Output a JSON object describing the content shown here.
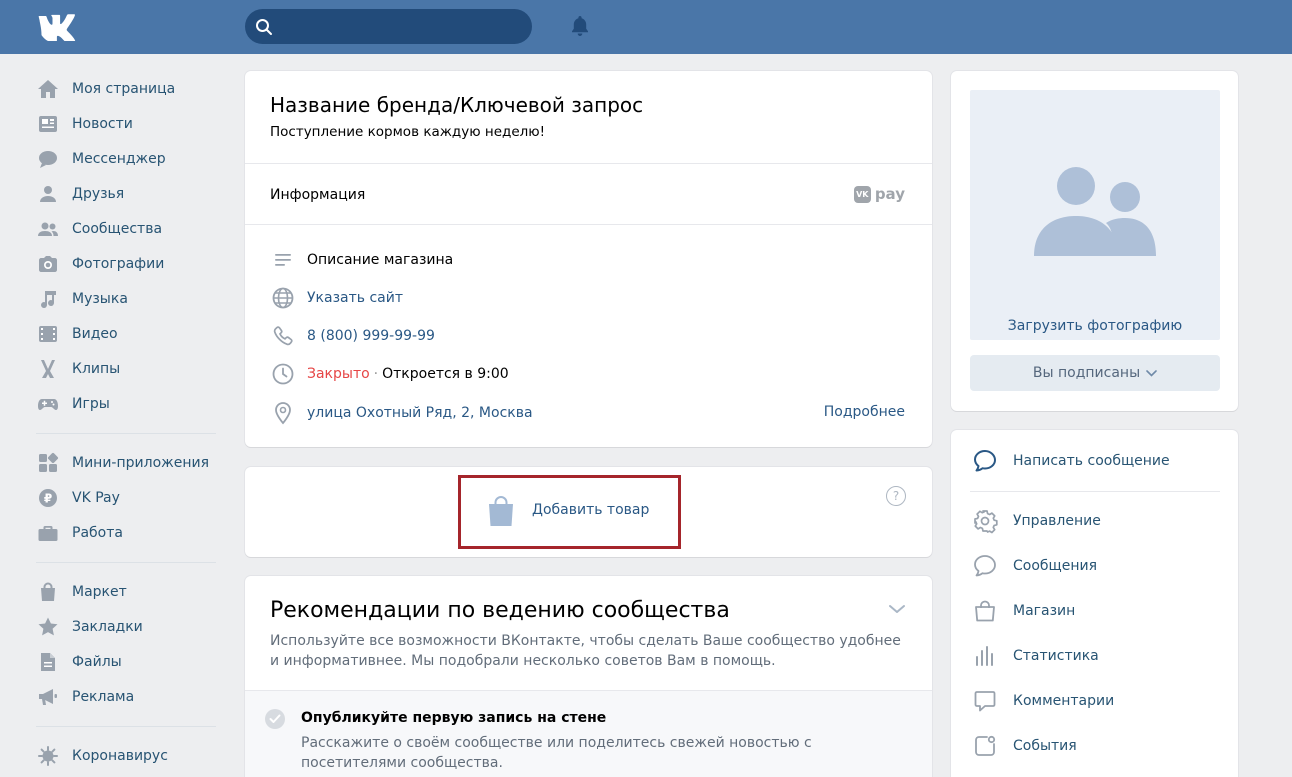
{
  "header": {
    "logo_text": "VK"
  },
  "nav": {
    "items": [
      {
        "label": "Моя страница",
        "icon": "home-icon"
      },
      {
        "label": "Новости",
        "icon": "news-icon"
      },
      {
        "label": "Мессенджер",
        "icon": "messenger-icon"
      },
      {
        "label": "Друзья",
        "icon": "friends-icon"
      },
      {
        "label": "Сообщества",
        "icon": "communities-icon"
      },
      {
        "label": "Фотографии",
        "icon": "camera-icon"
      },
      {
        "label": "Музыка",
        "icon": "music-icon"
      },
      {
        "label": "Видео",
        "icon": "video-icon"
      },
      {
        "label": "Клипы",
        "icon": "clips-icon"
      },
      {
        "label": "Игры",
        "icon": "gamepad-icon"
      },
      {
        "label": "Мини-приложения",
        "icon": "mini-apps-icon"
      },
      {
        "label": "VK Pay",
        "icon": "vkpay-icon"
      },
      {
        "label": "Работа",
        "icon": "briefcase-icon"
      },
      {
        "label": "Маркет",
        "icon": "market-icon"
      },
      {
        "label": "Закладки",
        "icon": "star-icon"
      },
      {
        "label": "Файлы",
        "icon": "file-icon"
      },
      {
        "label": "Реклама",
        "icon": "ads-icon"
      },
      {
        "label": "Коронавирус",
        "icon": "virus-icon"
      }
    ]
  },
  "community": {
    "title": "Название бренда/Ключевой запрос",
    "status": "Поступление кормов каждую неделю!",
    "info_label": "Информация",
    "vkpay_label": "pay",
    "description": "Описание магазина",
    "website": "Указать сайт",
    "phone": "8 (800) 999-99-99",
    "closed": "Закрыто",
    "separator": "·",
    "opens": "Откроется в 9:00",
    "address": "улица Охотный Ряд, 2, Москва",
    "more": "Подробнее"
  },
  "products": {
    "add_label": "Добавить товар",
    "help": "?"
  },
  "recommendations": {
    "title": "Рекомендации по ведению сообщества",
    "description": "Используйте все возможности ВКонтакте, чтобы сделать Ваше сообщество удобнее и информативнее. Мы подобрали несколько советов Вам в помощь.",
    "item_title": "Опубликуйте первую запись на стене",
    "item_desc": "Расскажите о своём сообществе или поделитесь свежей новостью с посетителями сообщества."
  },
  "sidebar_right": {
    "upload_photo": "Загрузить фотографию",
    "subscribed": "Вы подписаны",
    "actions": [
      {
        "label": "Написать сообщение",
        "icon": "message-bubble-icon"
      },
      {
        "label": "Управление",
        "icon": "gear-icon"
      },
      {
        "label": "Сообщения",
        "icon": "chat-icon"
      },
      {
        "label": "Магазин",
        "icon": "shop-bag-icon"
      },
      {
        "label": "Статистика",
        "icon": "stats-icon"
      },
      {
        "label": "Комментарии",
        "icon": "comments-icon"
      },
      {
        "label": "События",
        "icon": "events-icon"
      }
    ]
  },
  "colors": {
    "header": "#4a76a8",
    "link": "#2a5885",
    "closed": "#e64646",
    "highlight_frame": "#a5252b"
  }
}
